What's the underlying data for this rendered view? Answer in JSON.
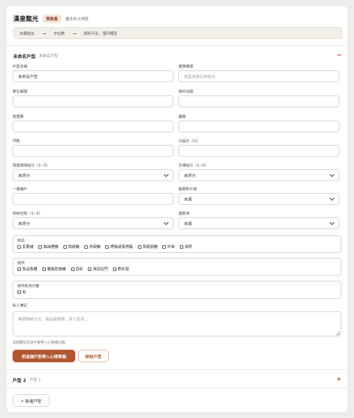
{
  "header": {
    "title": "漢皇懿光",
    "tag": "預售屋",
    "location": "臺北市士林區"
  },
  "stats": {
    "recent_label": "本顧成交",
    "recent_value": "—",
    "median_label": "中位數",
    "median_value": "—",
    "note": "資料不足，僅列備查"
  },
  "unit1": {
    "title": "未命名戶型",
    "subtitle": "未命名戶型",
    "toggle": "−",
    "fields": {
      "name": {
        "label": "戶型名稱",
        "value": "未命名戶型"
      },
      "agent_quote": {
        "label": "業務報價",
        "placeholder": "依藍原單位與說法"
      },
      "unit_price": {
        "label": "車位報價",
        "value": ""
      },
      "my_bid": {
        "label": "我的出價",
        "value": ""
      },
      "mgmt_fee": {
        "label": "管理費",
        "value": ""
      },
      "floor": {
        "label": "樓層",
        "value": ""
      },
      "ping": {
        "label": "坪數",
        "value": ""
      },
      "public_ratio": {
        "label": "公設比（%）",
        "value": ""
      },
      "env_score": {
        "label": "周邊環境給分（1−5）",
        "value": "未評分"
      },
      "traffic_score": {
        "label": "交通給分（1−5）",
        "value": "未評分"
      },
      "units_per_floor": {
        "label": "一層幾戶",
        "value": ""
      },
      "ext_window": {
        "label": "客廳對外窗",
        "value": "未填"
      },
      "storage": {
        "label": "收納空間（1−5）",
        "value": "未評分"
      },
      "renovation": {
        "label": "建案演",
        "value": "未填"
      }
    },
    "kitchen": {
      "label": "廚具",
      "items": [
        "瓦斯爐",
        "抽油煙機",
        "烘碗機",
        "洗碗機",
        "烤箱或蒸烤箱",
        "系統廚櫃",
        "中島",
        "未附"
      ]
    },
    "bathroom": {
      "label": "廁所",
      "items": [
        "免治馬桶",
        "暖風乾燥機",
        "浴缸",
        "淋浴拉門",
        "對外窗"
      ]
    },
    "dry_wet": {
      "label": "廁所乾濕分離",
      "items": [
        "有"
      ]
    },
    "memo": {
      "label": "私人筆記",
      "placeholder": "業務聯絡方式、樣品屋觀察、家人意見…"
    },
    "note": "這個欄位永遠不會帶入心得或公開。",
    "primary_button": "把這個戶型帶入心得草稿",
    "remove_button": "移除戶型"
  },
  "unit2": {
    "title": "戶型 2",
    "subtitle": "戶型 2",
    "toggle": "+"
  },
  "add_button": "+ 新增戶型"
}
